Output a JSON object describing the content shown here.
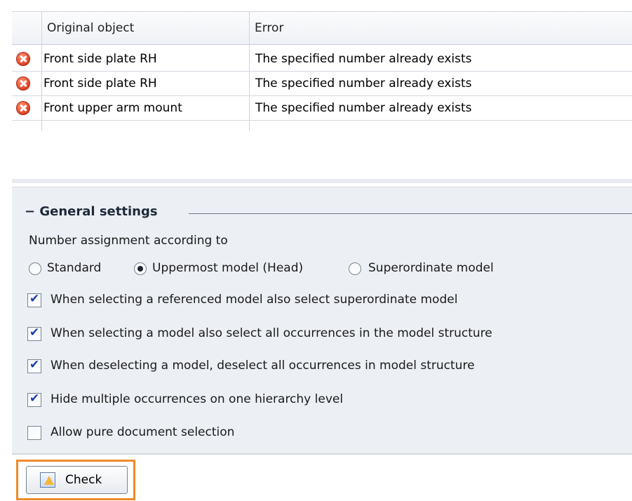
{
  "table": {
    "columns": [
      "Original object",
      "Error"
    ],
    "rows": [
      {
        "icon": "error-icon",
        "object": "Front side plate RH",
        "error": "The specified number already exists"
      },
      {
        "icon": "error-icon",
        "object": "Front side plate RH",
        "error": "The specified number already exists"
      },
      {
        "icon": "error-icon",
        "object": "Front upper arm mount",
        "error": "The specified number already exists"
      }
    ]
  },
  "settings": {
    "title": "General settings",
    "collapse_symbol": "−",
    "number_assignment_label": "Number assignment according to",
    "radios": [
      {
        "label": "Standard",
        "selected": false
      },
      {
        "label": "Uppermost model (Head)",
        "selected": true
      },
      {
        "label": "Superordinate model",
        "selected": false
      }
    ],
    "checkboxes": [
      {
        "label": "When selecting a referenced model also select superordinate model",
        "checked": true
      },
      {
        "label": "When selecting a model also select all occurrences in the model structure",
        "checked": true
      },
      {
        "label": "When deselecting a model, deselect all occurrences in model structure",
        "checked": true
      },
      {
        "label": "Hide multiple occurrences on one hierarchy level",
        "checked": true
      },
      {
        "label": "Allow pure document selection",
        "checked": false
      }
    ],
    "check_mark": "✔"
  },
  "button": {
    "label": "Check",
    "icon": "check-warning-icon"
  },
  "colors": {
    "focus": "#ef8a2a",
    "error": "#e0452a",
    "panel": "#eceff4"
  }
}
